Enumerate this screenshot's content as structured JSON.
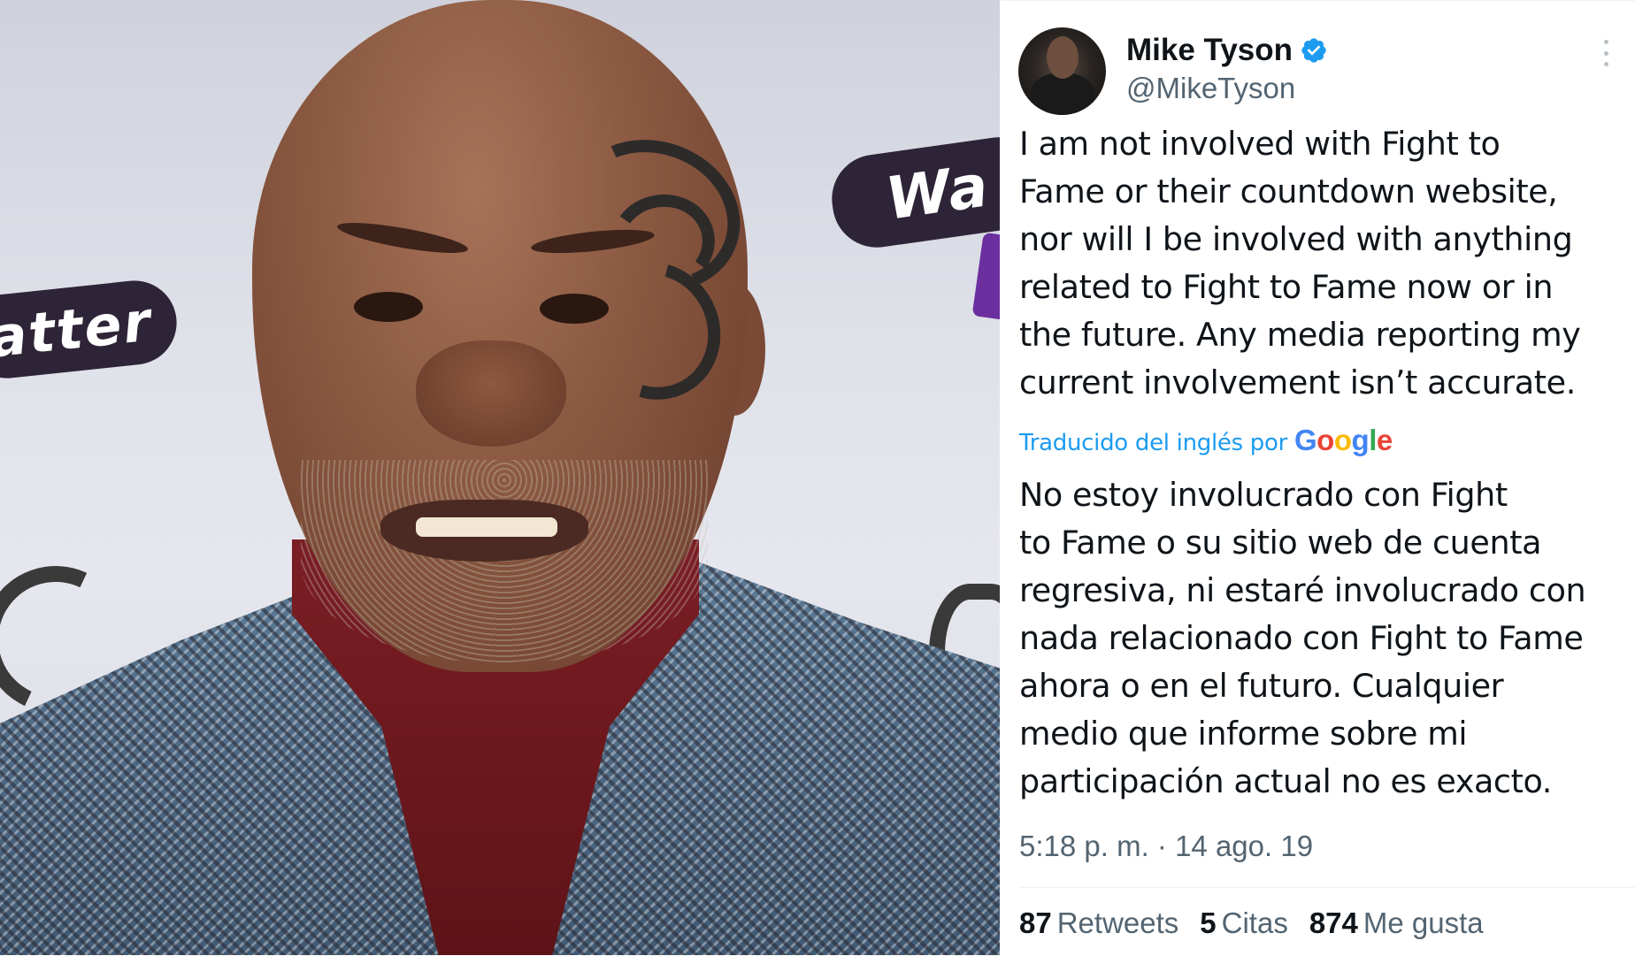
{
  "photo": {
    "backdrop_text_left": "atter",
    "backdrop_text_right": "Wa"
  },
  "tweet": {
    "author_name": "Mike Tyson",
    "author_handle": "@MikeTyson",
    "verified_color": "#1d9bf0",
    "text": "I am not involved with Fight to\nFame or their countdown website,\nnor will I be involved with anything\nrelated to Fight to Fame now or in\nthe future. Any media reporting my\ncurrent involvement isn’t accurate.",
    "translated_by": "Traducido del inglés por",
    "translator_brand": [
      "G",
      "o",
      "o",
      "g",
      "l",
      "e"
    ],
    "translator_brand_colors": [
      "#4285F4",
      "#EA4335",
      "#FBBC05",
      "#4285F4",
      "#34A853",
      "#EA4335"
    ],
    "translation": "No estoy involucrado con Fight\nto Fame o su sitio web de cuenta\nregresiva, ni estaré involucrado con\nnada relacionado con Fight to Fame\nahora o en el futuro. Cualquier\nmedio que informe sobre mi\nparticipación actual no es exacto.",
    "timestamp": "5:18 p. m. · 14 ago. 19",
    "stats": [
      {
        "count": "87",
        "label": "Retweets"
      },
      {
        "count": "5",
        "label": "Citas"
      },
      {
        "count": "874",
        "label": "Me gusta"
      }
    ]
  }
}
